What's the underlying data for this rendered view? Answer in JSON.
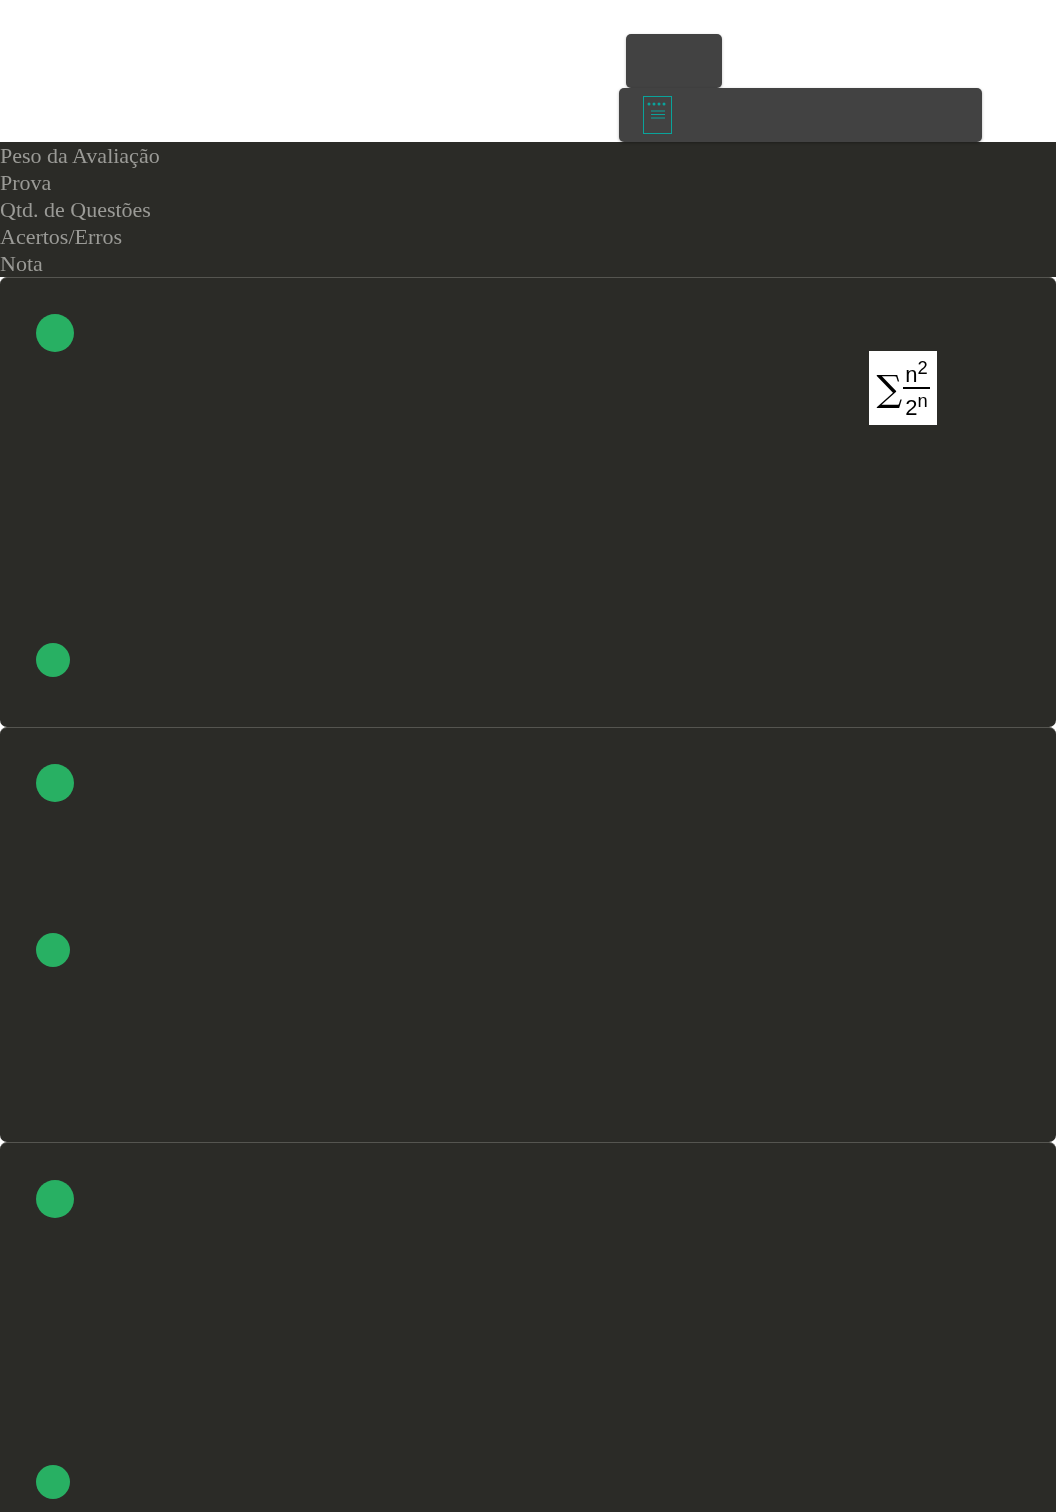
{
  "summary_labels": [
    "Peso da Avaliação",
    "Prova",
    "Qtd. de Questões",
    "Acertos/Erros",
    "Nota"
  ],
  "questions": [
    {
      "kind": "formula",
      "formula": {
        "operator": "∑",
        "numerator": "n$^{2}$",
        "denominator": "2$^{n}$"
      }
    },
    {
      "kind": "plain"
    },
    {
      "kind": "plain"
    }
  ]
}
